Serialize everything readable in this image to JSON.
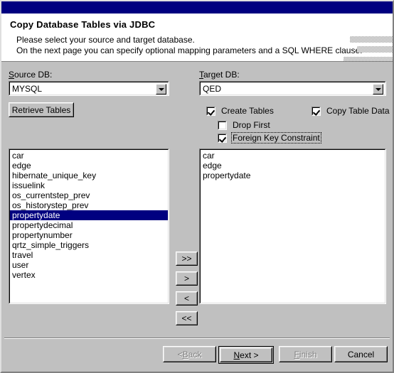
{
  "window": {
    "titlebar_color": "#000080",
    "face_color": "#c0c0c0"
  },
  "header": {
    "title": "Copy Database Tables via JDBC",
    "line1": "Please select your source and target database.",
    "line2": "On the next page you can specify optional mapping parameters and a SQL WHERE clause."
  },
  "source": {
    "label_pre": "S",
    "label_post": "ource DB:",
    "combo_value": "MYSQL",
    "retrieve_button": "Retrieve Tables",
    "items": [
      "car",
      "edge",
      "hibernate_unique_key",
      "issuelink",
      "os_currentstep_prev",
      "os_historystep_prev",
      "propertydate",
      "propertydecimal",
      "propertynumber",
      "qrtz_simple_triggers",
      "travel",
      "user",
      "vertex"
    ],
    "selected_index": 6
  },
  "target": {
    "label_pre": "T",
    "label_post": "arget DB:",
    "combo_value": "QED",
    "items": [
      "car",
      "edge",
      "propertydate"
    ]
  },
  "options": {
    "create_tables": {
      "label": "Create Tables",
      "checked": true
    },
    "copy_table_data": {
      "label": "Copy Table Data",
      "checked": true
    },
    "drop_first": {
      "label": "Drop First",
      "checked": false
    },
    "foreign_key_constraint": {
      "label": "Foreign Key Constraint",
      "checked": true,
      "focused": true
    }
  },
  "transfer": {
    "add_all": ">>",
    "add_one": ">",
    "remove_one": "<",
    "remove_all": "<<"
  },
  "footer": {
    "back_pre": "< ",
    "back_mnemonic": "B",
    "back_post": "ack",
    "next_mnemonic": "N",
    "next_post": "ext >",
    "finish_mnemonic": "F",
    "finish_post": "inish",
    "cancel": "Cancel"
  }
}
